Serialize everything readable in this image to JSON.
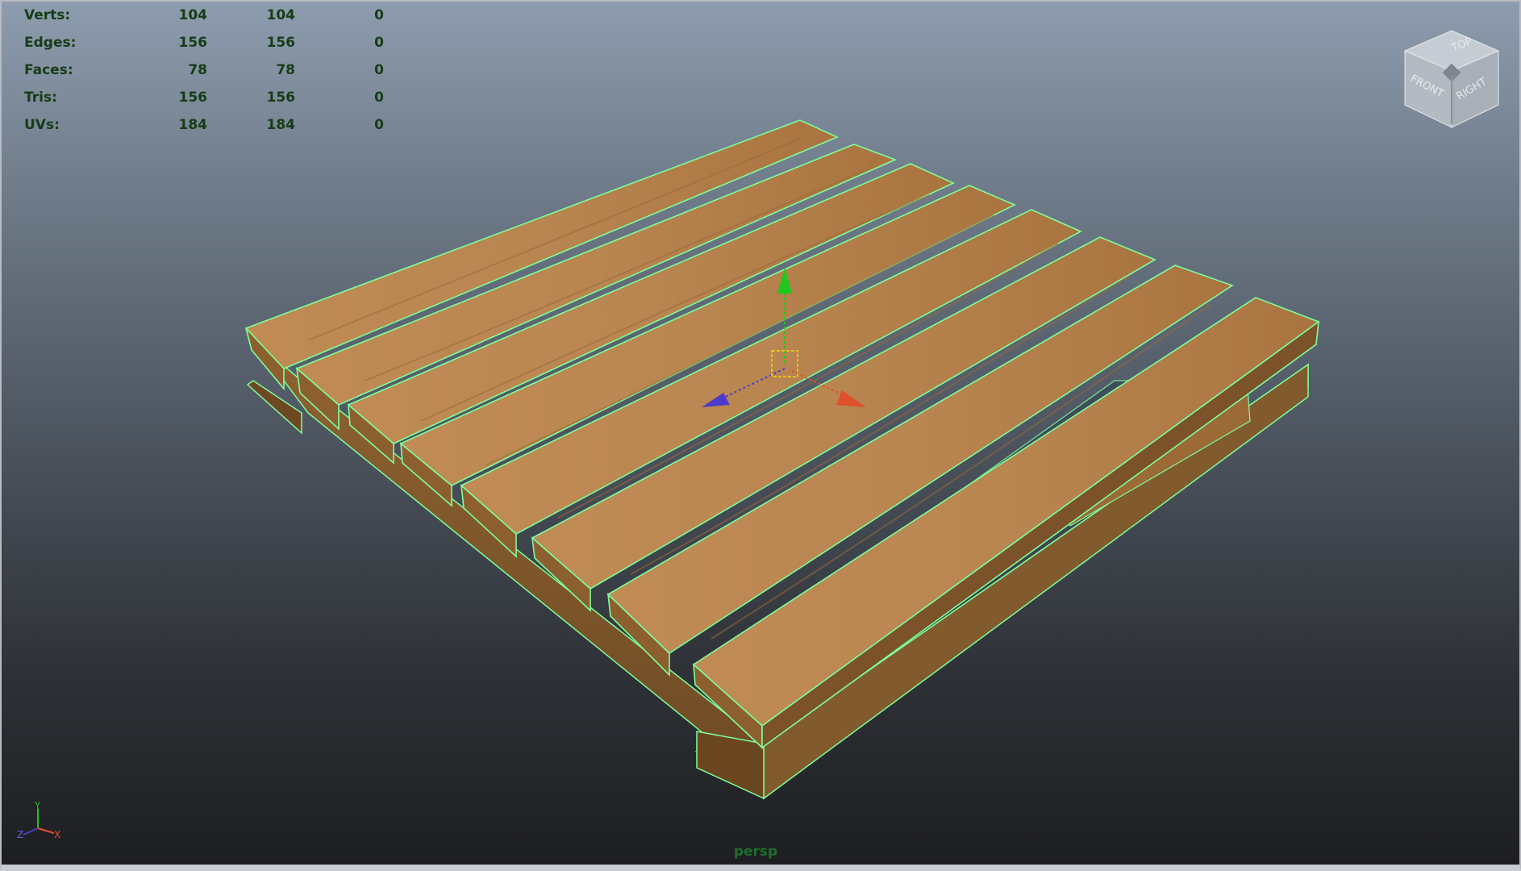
{
  "hud": {
    "rows": [
      {
        "label": "Verts:",
        "v1": "104",
        "v2": "104",
        "v3": "0"
      },
      {
        "label": "Edges:",
        "v1": "156",
        "v2": "156",
        "v3": "0"
      },
      {
        "label": "Faces:",
        "v1": "78",
        "v2": "78",
        "v3": "0"
      },
      {
        "label": "Tris:",
        "v1": "156",
        "v2": "156",
        "v3": "0"
      },
      {
        "label": "UVs:",
        "v1": "184",
        "v2": "184",
        "v3": "0"
      }
    ]
  },
  "view_cube": {
    "top": "TOP",
    "front": "FRONT",
    "right": "RIGHT"
  },
  "axis_indicator": {
    "x": "X",
    "y": "Y",
    "z": "Z"
  },
  "camera": {
    "label": "persp"
  },
  "colors": {
    "selection_wire": "#7dff9a",
    "wood": "#b98550",
    "move_y": "#1ec81e",
    "move_x": "#e0502a",
    "move_z": "#4a3cc8",
    "pivot": "#e8c020"
  },
  "icons": [
    "view-cube-icon",
    "move-manipulator-icon",
    "axis-indicator-icon"
  ]
}
